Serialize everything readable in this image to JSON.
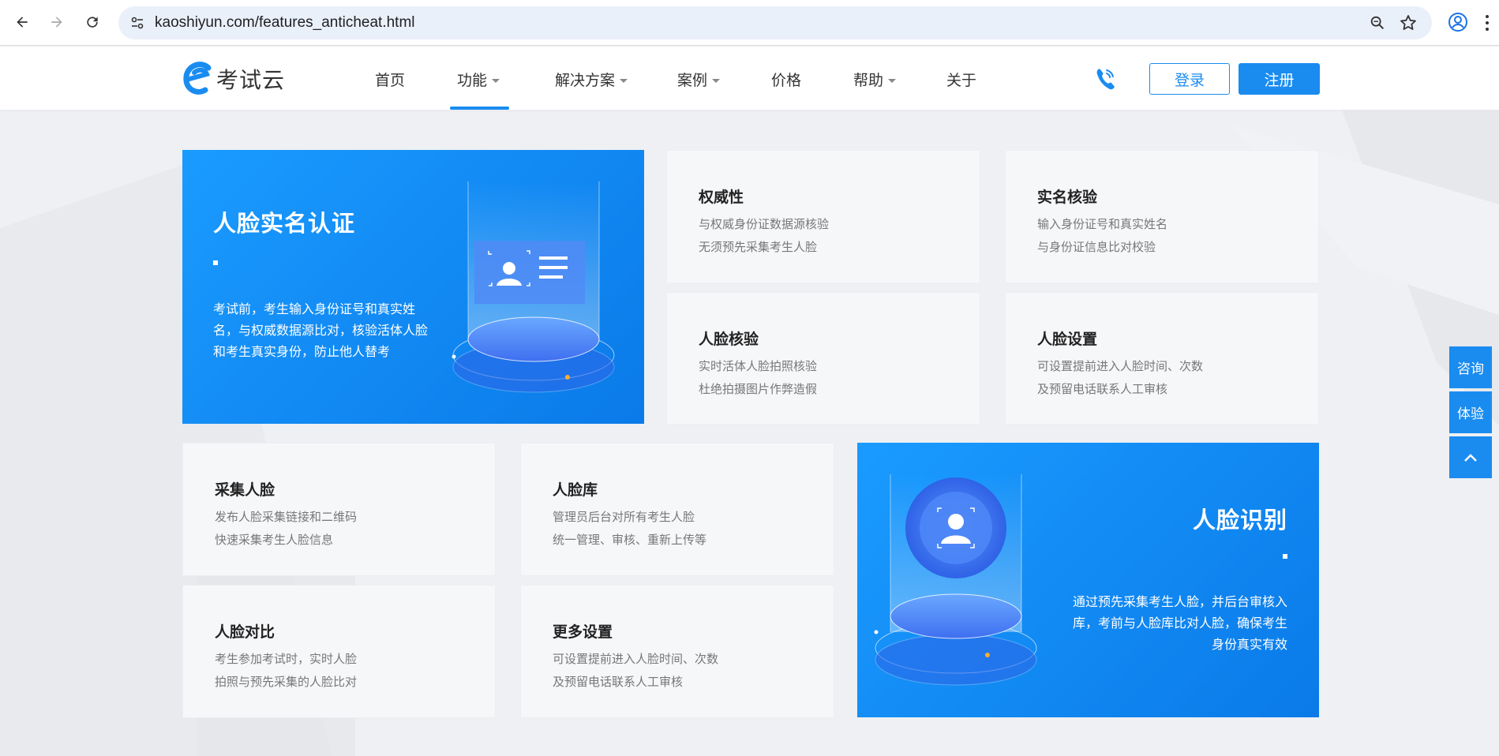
{
  "browser": {
    "url": "kaoshiyun.com/features_anticheat.html"
  },
  "header": {
    "logo_text": "考试云",
    "nav": [
      {
        "label": "首页",
        "has_caret": false
      },
      {
        "label": "功能",
        "has_caret": true,
        "active": true
      },
      {
        "label": "解决方案",
        "has_caret": true
      },
      {
        "label": "案例",
        "has_caret": true
      },
      {
        "label": "价格",
        "has_caret": false
      },
      {
        "label": "帮助",
        "has_caret": true
      },
      {
        "label": "关于",
        "has_caret": false
      }
    ],
    "login_label": "登录",
    "register_label": "注册"
  },
  "hero_left": {
    "title": "人脸实名认证",
    "lines": [
      "考试前，考生输入身份证号和真实姓",
      "名，与权威数据源比对，核验活体人脸",
      "和考生真实身份，防止他人替考"
    ]
  },
  "cards_top": [
    {
      "title": "权威性",
      "lines": [
        "与权威身份证数据源核验",
        "无须预先采集考生人脸"
      ]
    },
    {
      "title": "实名核验",
      "lines": [
        "输入身份证号和真实姓名",
        "与身份证信息比对校验"
      ]
    },
    {
      "title": "人脸核验",
      "lines": [
        "实时活体人脸拍照核验",
        "杜绝拍摄图片作弊造假"
      ]
    },
    {
      "title": "人脸设置",
      "lines": [
        "可设置提前进入人脸时间、次数",
        "及预留电话联系人工审核"
      ]
    }
  ],
  "cards_bottom": [
    {
      "title": "采集人脸",
      "lines": [
        "发布人脸采集链接和二维码",
        "快速采集考生人脸信息"
      ]
    },
    {
      "title": "人脸库",
      "lines": [
        "管理员后台对所有考生人脸",
        "统一管理、审核、重新上传等"
      ]
    },
    {
      "title": "人脸对比",
      "lines": [
        "考生参加考试时，实时人脸",
        "拍照与预先采集的人脸比对"
      ]
    },
    {
      "title": "更多设置",
      "lines": [
        "可设置提前进入人脸时间、次数",
        "及预留电话联系人工审核"
      ]
    }
  ],
  "hero_right": {
    "title": "人脸识别",
    "lines": [
      "通过预先采集考生人脸，并后台审核入",
      "库，考前与人脸库比对人脸，确保考生",
      "身份真实有效"
    ]
  },
  "float_buttons": {
    "consult": "咨询",
    "trial": "体验"
  },
  "colors": {
    "brand": "#1a8cf0",
    "hero_gradient_start": "#1a9bff",
    "hero_gradient_end": "#0a7ae8"
  }
}
